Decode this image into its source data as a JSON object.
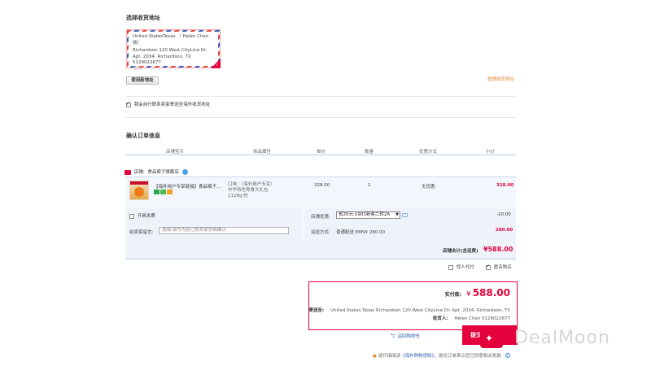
{
  "address_section": {
    "title": "选择收货地址",
    "card": {
      "line1": "United StatesTexas （ Helen Chen 收）",
      "line2": "Richardson  120 West CityLine Dr. Apt. 2034, Richardson, TX 5129022677",
      "edit": "修改"
    },
    "use_new_button": "使用新地址",
    "manage_link": "管理收货地址",
    "self_pickup_label": "我会自行联系卖家寄送至海外收货地址"
  },
  "order_section": {
    "title": "确认订单信息",
    "columns": [
      "店铺宝贝",
      "商品属性",
      "单价",
      "数量",
      "优惠方式",
      "小计"
    ],
    "shop": {
      "label": "店铺:",
      "name": "食品裤子旗舰店"
    },
    "item": {
      "title": "【海外用户专享链接】食品裤子...",
      "attributes": "口味：（海外用户专享）中华特色零食大礼包2128g/份",
      "price": "328.00",
      "quantity": "1",
      "discount": "无优惠",
      "subtotal": "328.00"
    },
    "invoice_label": "开具发票",
    "message_label": "给卖家留言:",
    "message_placeholder": "选填:填写内容已和卖家协商确认",
    "shop_coupon_label": "店铺优惠:",
    "shop_coupon_value": "省20元:1901新客二转2A",
    "shop_coupon_amount": "-20.00",
    "shipping_label": "运送方式:",
    "shipping_value": "普通配送 EMS¥ 280.00",
    "shipping_amount": "280.00",
    "shop_total_label": "店铺合计(含运费)",
    "shop_total_value": "¥588.00",
    "proxy_pay_label": "找人代付",
    "anonymous_label": "匿名购买"
  },
  "summary": {
    "pay_label": "实付款:",
    "currency": "¥",
    "amount": "588.00",
    "ship_to_label": "寄送至:",
    "ship_to_value": "United States Texas Richardson 120 West CityLine Dr. Apt. 2034, Richardson, TX",
    "receiver_label": "收货人:",
    "receiver_value": "Helen Chen 5129022677"
  },
  "actions": {
    "back_to_cart": "返回购物车",
    "submit_button": "提交订单",
    "notice_prefix": "请仔细阅读",
    "notice_link": "《海外购物须知》",
    "notice_suffix": "，提交订单表示您已同意相关条款"
  },
  "watermark": {
    "text": "DealMoon"
  },
  "colors": {
    "accent": "#e4003a",
    "link": "#2d5fb3",
    "table_bg": "#f3f7fd"
  }
}
